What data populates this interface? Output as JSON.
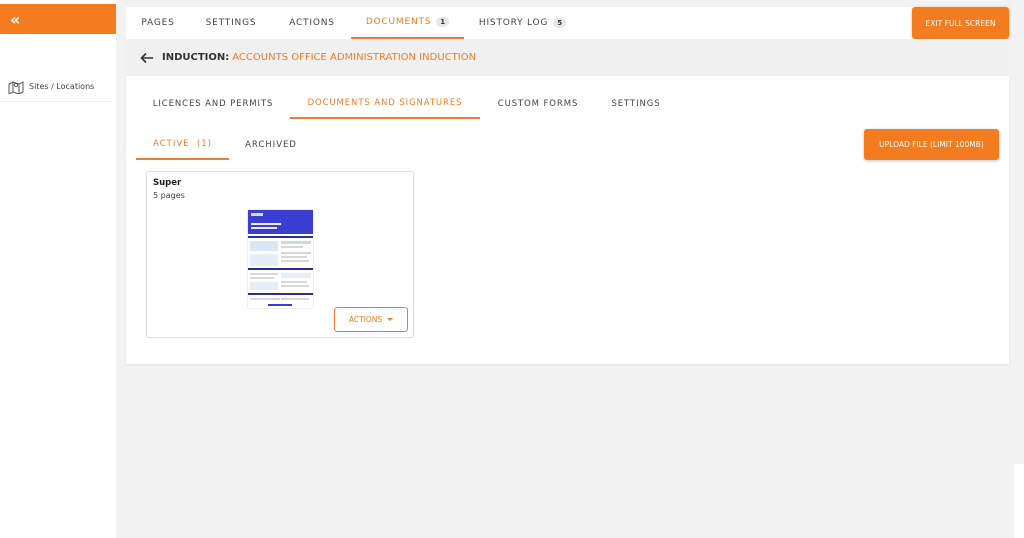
{
  "sidebar": {
    "collapse_glyph": "«",
    "items": [
      {
        "label": "Sites / Locations",
        "icon": "map-icon"
      }
    ]
  },
  "topnav": {
    "tabs": [
      {
        "label": "PAGES"
      },
      {
        "label": "SETTINGS"
      },
      {
        "label": "ACTIONS"
      },
      {
        "label": "DOCUMENTS",
        "badge": "1",
        "active": true
      },
      {
        "label": "HISTORY LOG",
        "badge": "5"
      }
    ],
    "exit_label": "EXIT FULL SCREEN"
  },
  "breadcrumb": {
    "label": "INDUCTION:",
    "value": "ACCOUNTS OFFICE ADMINISTRATION INDUCTION"
  },
  "subtabs": [
    {
      "label": "LICENCES AND PERMITS"
    },
    {
      "label": "DOCUMENTS AND SIGNATURES",
      "active": true
    },
    {
      "label": "CUSTOM FORMS"
    },
    {
      "label": "SETTINGS"
    }
  ],
  "inner_tabs": [
    {
      "label": "ACTIVE  (1)",
      "active": true
    },
    {
      "label": "ARCHIVED"
    }
  ],
  "upload_label": "UPLOAD FILE (LIMIT 100MB)",
  "documents": [
    {
      "title": "Super",
      "pages": "5 pages",
      "actions_label": "ACTIONS"
    }
  ],
  "colors": {
    "accent": "#f47c20",
    "background": "#f2f2f2",
    "panel": "#ffffff"
  }
}
